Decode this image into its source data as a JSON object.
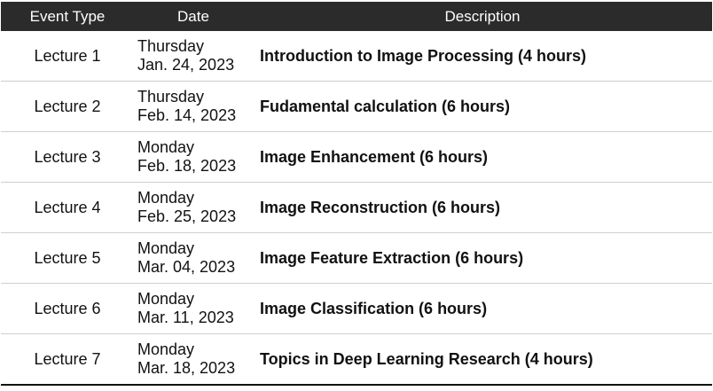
{
  "header": {
    "event_type": "Event Type",
    "date": "Date",
    "description": "Description"
  },
  "rows": [
    {
      "event_type": "Lecture 1",
      "day": "Thursday",
      "date": "Jan. 24, 2023",
      "description": "Introduction to Image Processing (4 hours)"
    },
    {
      "event_type": "Lecture 2",
      "day": "Thursday",
      "date": "Feb. 14, 2023",
      "description": "Fudamental calculation (6 hours)"
    },
    {
      "event_type": "Lecture 3",
      "day": "Monday",
      "date": "Feb. 18, 2023",
      "description": "Image Enhancement (6 hours)"
    },
    {
      "event_type": "Lecture 4",
      "day": "Monday",
      "date": "Feb. 25, 2023",
      "description": "Image Reconstruction (6 hours)"
    },
    {
      "event_type": "Lecture 5",
      "day": "Monday",
      "date": "Mar. 04, 2023",
      "description": "Image Feature Extraction  (6 hours)"
    },
    {
      "event_type": "Lecture 6",
      "day": "Monday",
      "date": "Mar. 11, 2023",
      "description": "Image Classification (6 hours)"
    },
    {
      "event_type": "Lecture 7",
      "day": "Monday",
      "date": "Mar. 18, 2023",
      "description": "Topics in Deep Learning Research (4 hours)"
    }
  ]
}
